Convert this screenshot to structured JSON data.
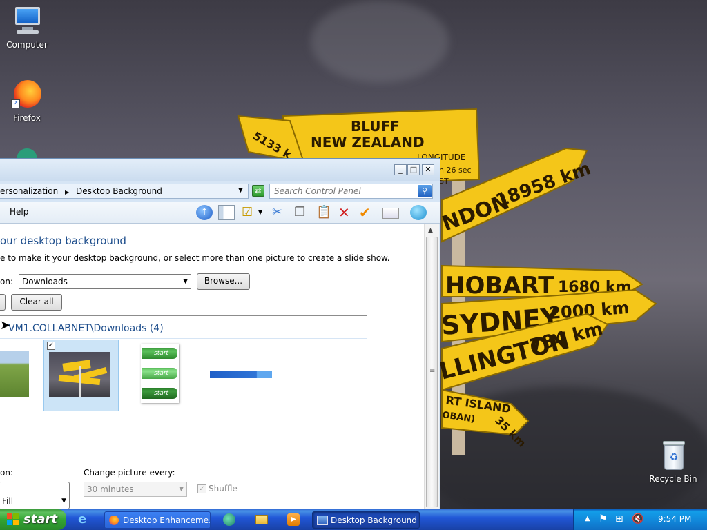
{
  "desktop": {
    "icons": [
      {
        "label": "Computer"
      },
      {
        "label": "Firefox"
      },
      {
        "label": "Recycle Bin"
      }
    ],
    "wallpaper_text": {
      "bluff": "BLUFF",
      "nz": "NEW ZEALAND",
      "longitude": "LONGITUDE",
      "sec": "n 26 sec",
      "st": "ST",
      "distance_5133": "5133 k",
      "london": "NDON",
      "london_km": "18958 km",
      "hobart": "HOBART",
      "hobart_km": "1680 km",
      "sydney": "SYDNEY",
      "sydney_km": "2000 km",
      "wellington": "LLINGTON",
      "wellington_km": "784 km",
      "island": "RT ISLAND",
      "oban": "OBAN)",
      "island_km": "35 km"
    }
  },
  "window": {
    "controls": {
      "minimize": "_",
      "maximize": "□",
      "close": "✕"
    },
    "breadcrumb": [
      "ersonalization",
      "Desktop Background"
    ],
    "search_placeholder": "Search Control Panel",
    "menu": {
      "help": "Help"
    },
    "heading": "our desktop background",
    "instructions": "e to make it your desktop background, or select more than one picture to create a slide show.",
    "location_label": "on:",
    "location_value": "Downloads",
    "browse_label": "Browse...",
    "clear_all_label": "Clear all",
    "group_header": "VM1.COLLABNET\\Downloads (4)",
    "picture_position_label": "on:",
    "picture_position_value": "Fill",
    "change_picture_label": "Change picture every:",
    "change_picture_value": "30 minutes",
    "shuffle_label": "Shuffle",
    "thumb_start_labels": [
      "start",
      "start",
      "start"
    ]
  },
  "taskbar": {
    "start_label": "start",
    "tasks": [
      {
        "label": "Desktop Enhanceme..."
      },
      {
        "label": "Desktop Background"
      }
    ],
    "clock": "9:54 PM"
  },
  "colors": {
    "heading_blue": "#1e4e8c",
    "taskbar_blue": "#2157d7",
    "start_green": "#33a433",
    "sign_yellow": "#f4c619"
  }
}
